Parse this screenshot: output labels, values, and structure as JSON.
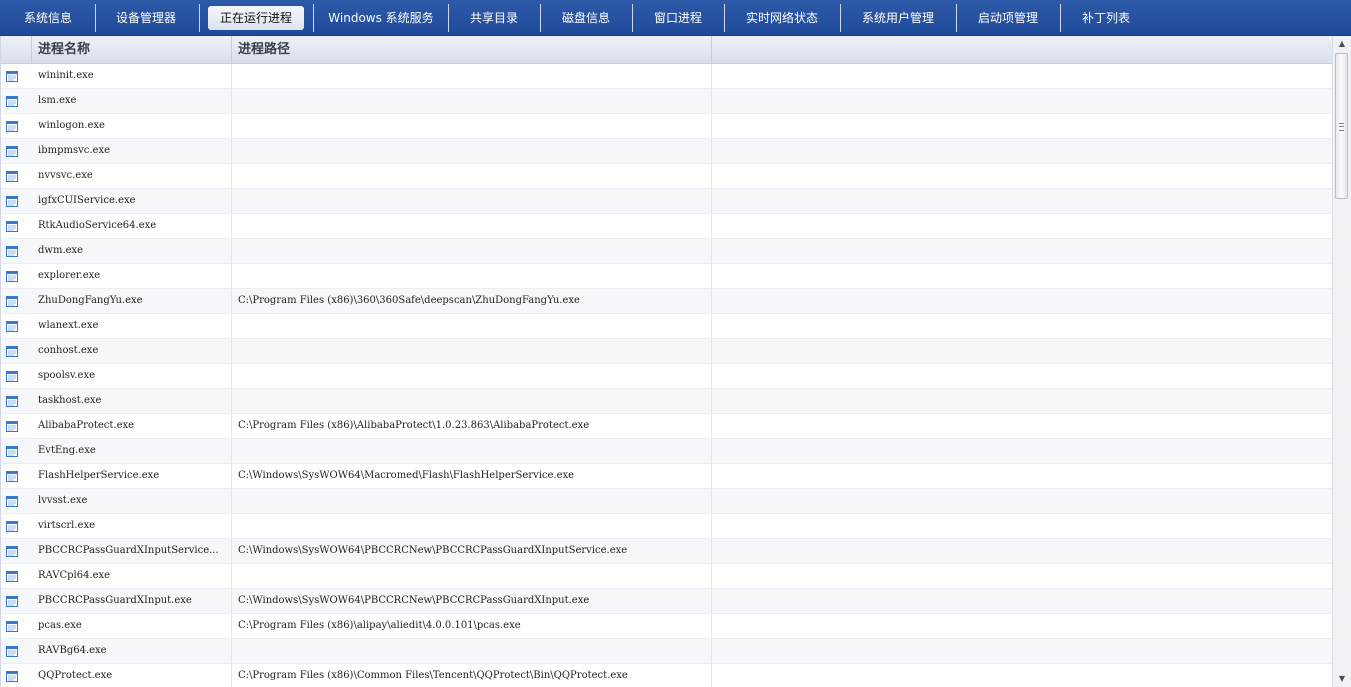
{
  "tabs": [
    {
      "label": "系统信息",
      "active": false
    },
    {
      "label": "设备管理器",
      "active": false
    },
    {
      "label": "正在运行进程",
      "active": true
    },
    {
      "label": "Windows 系统服务",
      "active": false
    },
    {
      "label": "共享目录",
      "active": false
    },
    {
      "label": "磁盘信息",
      "active": false
    },
    {
      "label": "窗口进程",
      "active": false
    },
    {
      "label": "实时网络状态",
      "active": false
    },
    {
      "label": "系统用户管理",
      "active": false
    },
    {
      "label": "启动项管理",
      "active": false
    },
    {
      "label": "补丁列表",
      "active": false
    }
  ],
  "table": {
    "columns": [
      "进程名称",
      "进程路径"
    ],
    "rows": [
      {
        "name": "wininit.exe",
        "path": ""
      },
      {
        "name": "lsm.exe",
        "path": ""
      },
      {
        "name": "winlogon.exe",
        "path": ""
      },
      {
        "name": "ibmpmsvc.exe",
        "path": ""
      },
      {
        "name": "nvvsvc.exe",
        "path": ""
      },
      {
        "name": "igfxCUIService.exe",
        "path": ""
      },
      {
        "name": "RtkAudioService64.exe",
        "path": ""
      },
      {
        "name": "dwm.exe",
        "path": ""
      },
      {
        "name": "explorer.exe",
        "path": ""
      },
      {
        "name": "ZhuDongFangYu.exe",
        "path": "C:\\Program Files (x86)\\360\\360Safe\\deepscan\\ZhuDongFangYu.exe"
      },
      {
        "name": "wlanext.exe",
        "path": ""
      },
      {
        "name": "conhost.exe",
        "path": ""
      },
      {
        "name": "spoolsv.exe",
        "path": ""
      },
      {
        "name": "taskhost.exe",
        "path": ""
      },
      {
        "name": "AlibabaProtect.exe",
        "path": "C:\\Program Files (x86)\\AlibabaProtect\\1.0.23.863\\AlibabaProtect.exe"
      },
      {
        "name": "EvtEng.exe",
        "path": ""
      },
      {
        "name": "FlashHelperService.exe",
        "path": "C:\\Windows\\SysWOW64\\Macromed\\Flash\\FlashHelperService.exe"
      },
      {
        "name": "lvvsst.exe",
        "path": ""
      },
      {
        "name": "virtscrl.exe",
        "path": ""
      },
      {
        "name": "PBCCRCPassGuardXInputService...",
        "path": "C:\\Windows\\SysWOW64\\PBCCRCNew\\PBCCRCPassGuardXInputService.exe"
      },
      {
        "name": "RAVCpl64.exe",
        "path": ""
      },
      {
        "name": "PBCCRCPassGuardXInput.exe",
        "path": "C:\\Windows\\SysWOW64\\PBCCRCNew\\PBCCRCPassGuardXInput.exe"
      },
      {
        "name": "pcas.exe",
        "path": "C:\\Program Files (x86)\\alipay\\aliedit\\4.0.0.101\\pcas.exe"
      },
      {
        "name": "RAVBg64.exe",
        "path": ""
      },
      {
        "name": "QQProtect.exe",
        "path": "C:\\Program Files (x86)\\Common Files\\Tencent\\QQProtect\\Bin\\QQProtect.exe"
      }
    ]
  },
  "icons": {
    "row_icon": "process-window-icon",
    "scroll_up": "scroll-up-arrow-icon",
    "scroll_down": "scroll-down-arrow-icon"
  },
  "colors": {
    "tabbar": "#2456a6",
    "active_tab": "#e4e8f0",
    "row_icon": "#3a78c8"
  }
}
